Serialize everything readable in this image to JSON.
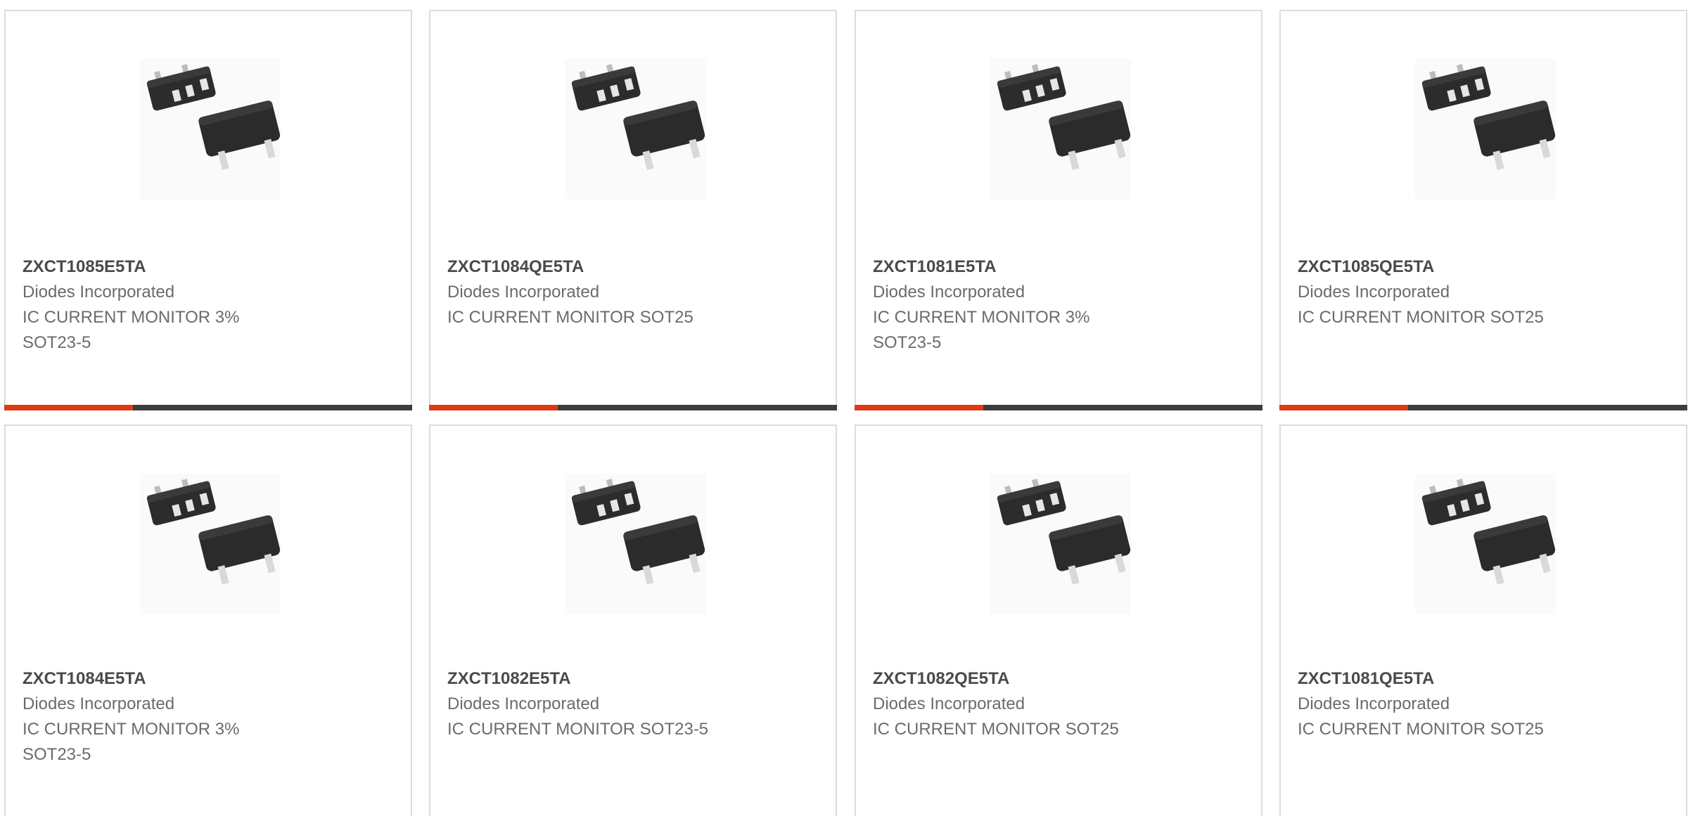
{
  "colors": {
    "accent": "#e03a12",
    "bar": "#3c3c3c",
    "border": "#dcdcdc",
    "part_text": "#4a4a4a",
    "body_text": "#6b6b6b"
  },
  "products": [
    {
      "part": "ZXCT1085E5TA",
      "manufacturer": "Diodes Incorporated",
      "description": "IC CURRENT MONITOR 3% SOT23-5",
      "image_icon": "sot23-5-package-icon"
    },
    {
      "part": "ZXCT1084QE5TA",
      "manufacturer": "Diodes Incorporated",
      "description": "IC CURRENT MONITOR SOT25",
      "image_icon": "sot23-5-package-icon"
    },
    {
      "part": "ZXCT1081E5TA",
      "manufacturer": "Diodes Incorporated",
      "description": "IC CURRENT MONITOR 3% SOT23-5",
      "image_icon": "sot23-5-package-icon"
    },
    {
      "part": "ZXCT1085QE5TA",
      "manufacturer": "Diodes Incorporated",
      "description": "IC CURRENT MONITOR SOT25",
      "image_icon": "sot23-5-package-icon"
    },
    {
      "part": "ZXCT1084E5TA",
      "manufacturer": "Diodes Incorporated",
      "description": "IC CURRENT MONITOR 3% SOT23-5",
      "image_icon": "sot23-5-package-icon"
    },
    {
      "part": "ZXCT1082E5TA",
      "manufacturer": "Diodes Incorporated",
      "description": "IC CURRENT MONITOR SOT23-5",
      "image_icon": "sot23-5-package-icon"
    },
    {
      "part": "ZXCT1082QE5TA",
      "manufacturer": "Diodes Incorporated",
      "description": "IC CURRENT MONITOR SOT25",
      "image_icon": "sot23-5-package-icon"
    },
    {
      "part": "ZXCT1081QE5TA",
      "manufacturer": "Diodes Incorporated",
      "description": "IC CURRENT MONITOR SOT25",
      "image_icon": "sot23-5-package-icon"
    }
  ]
}
